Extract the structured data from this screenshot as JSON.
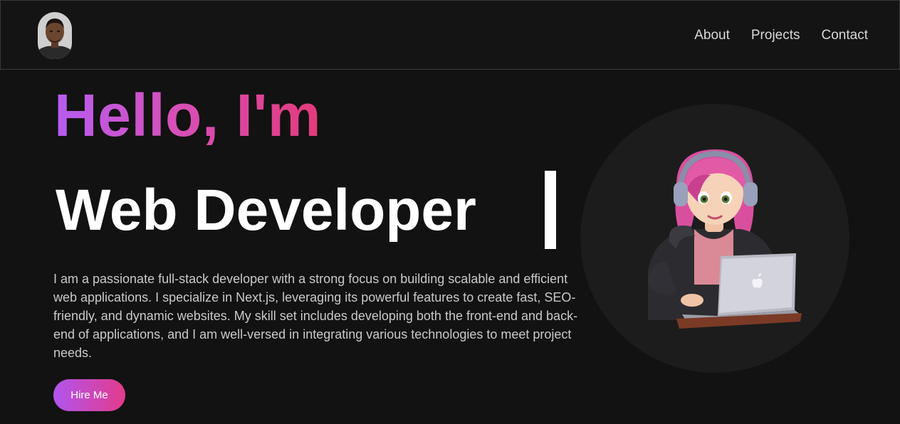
{
  "nav": {
    "links": [
      "About",
      "Projects",
      "Contact"
    ]
  },
  "hero": {
    "greeting": "Hello, I'm",
    "role": "Web Developer",
    "bio": "I am a passionate full-stack developer with a strong focus on building scalable and efficient web applications. I specialize in Next.js, leveraging its powerful features to create fast, SEO-friendly, and dynamic websites. My skill set includes developing both the front-end and back-end of applications, and I am well-versed in integrating various technologies to meet project needs.",
    "cta_label": "Hire Me"
  },
  "colors": {
    "background": "#121212",
    "gradient_start": "#b65cf2",
    "gradient_end": "#e33b7a",
    "text_primary": "#ffffff",
    "text_secondary": "#c9c9c9"
  }
}
